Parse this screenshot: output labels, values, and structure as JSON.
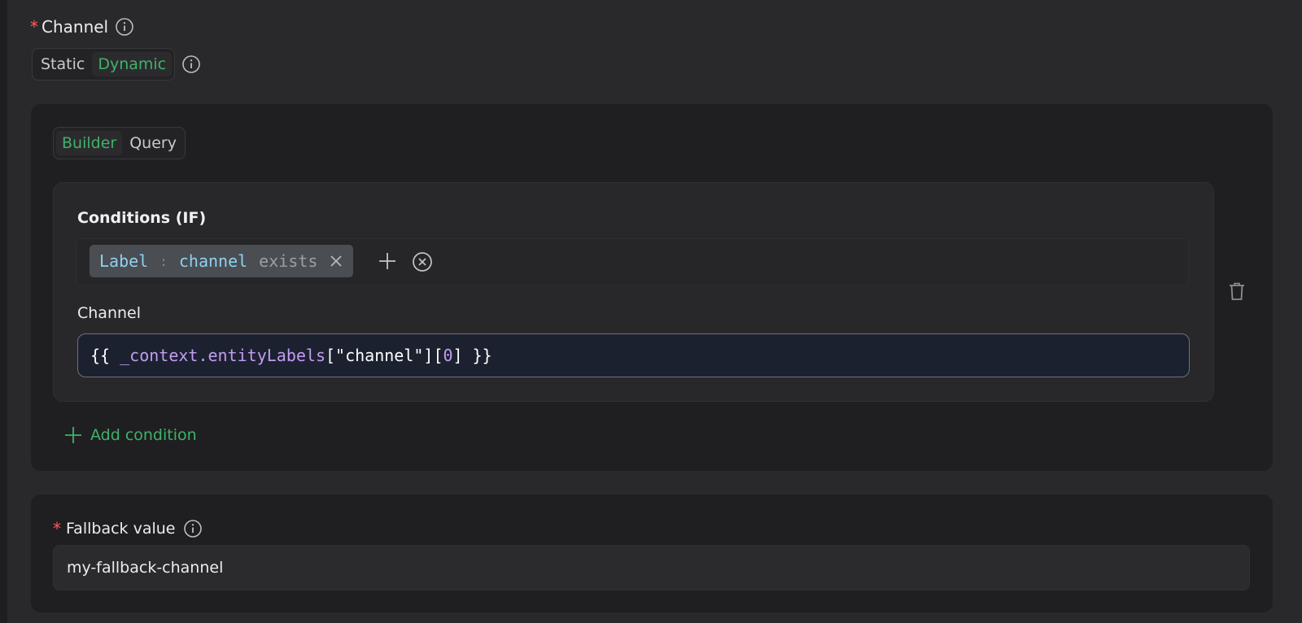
{
  "channel_field": {
    "required_marker": "*",
    "label": "Channel",
    "mode_toggle": {
      "options": [
        "Static",
        "Dynamic"
      ],
      "selected": "Dynamic"
    }
  },
  "builder_panel": {
    "tabs": [
      "Builder",
      "Query"
    ],
    "selected_tab": "Builder",
    "rule": {
      "conditions_title": "Conditions (IF)",
      "condition_chip": {
        "key": "Label",
        "separator": ":",
        "value": "channel",
        "operator": "exists"
      },
      "channel_label": "Channel",
      "channel_expression": {
        "open": "{{ ",
        "context": "_context",
        "dot": ".",
        "prop": "entityLabels",
        "mid": "[\"channel\"][",
        "index": "0",
        "close": "] }}"
      }
    },
    "add_condition_label": "Add condition"
  },
  "fallback_field": {
    "required_marker": "*",
    "label": "Fallback value",
    "value": "my-fallback-channel"
  },
  "colors": {
    "accent_green": "#3fb26a",
    "required_red": "#ff5b5b",
    "chip_blue": "#8fd0f2",
    "code_purple": "#c39cf2"
  }
}
